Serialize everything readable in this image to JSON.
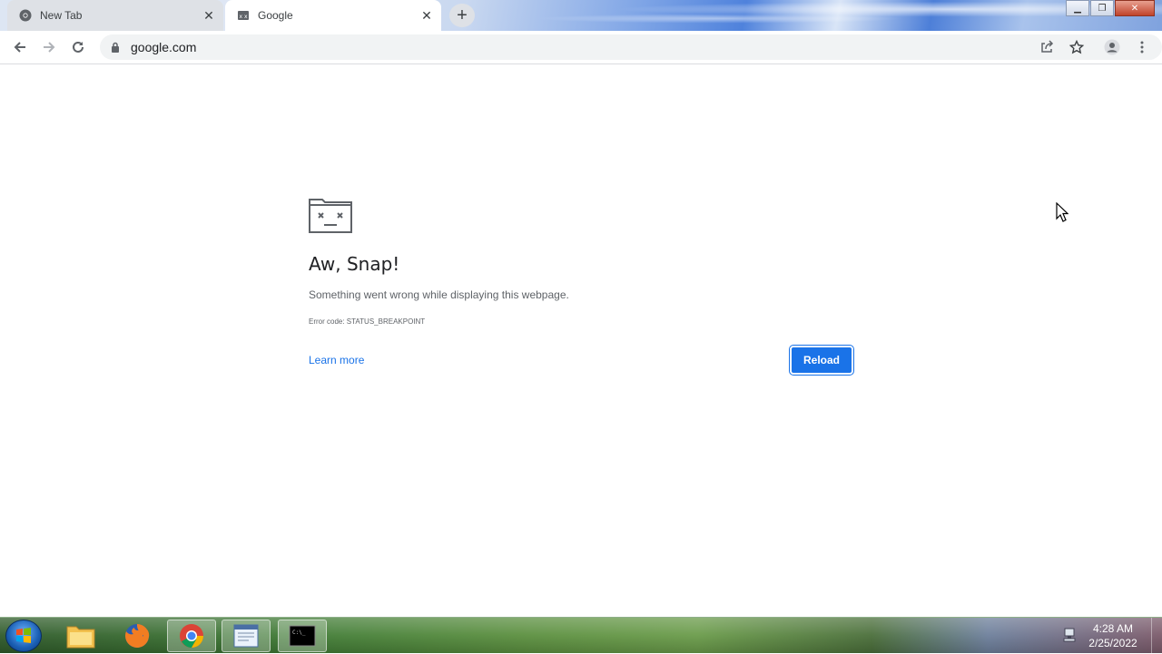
{
  "browser": {
    "tabs": [
      {
        "title": "New Tab",
        "icon": "chrome-icon",
        "active": false
      },
      {
        "title": "Google",
        "icon": "sad-tab-favicon",
        "active": true
      }
    ],
    "new_tab_label": "+",
    "address": "google.com"
  },
  "error_page": {
    "headline": "Aw, Snap!",
    "message": "Something went wrong while displaying this webpage.",
    "error_code": "Error code: STATUS_BREAKPOINT",
    "learn_more": "Learn more",
    "reload": "Reload"
  },
  "taskbar": {
    "apps": [
      "file-explorer-icon",
      "firefox-icon",
      "chrome-icon",
      "notepad-icon",
      "cmd-icon"
    ],
    "cmd_label": "C:\\_",
    "time": "4:28 AM",
    "date": "2/25/2022"
  },
  "colors": {
    "accent": "#1a73e8",
    "tab_inactive": "#dee1e6",
    "omnibox": "#f1f3f4"
  }
}
